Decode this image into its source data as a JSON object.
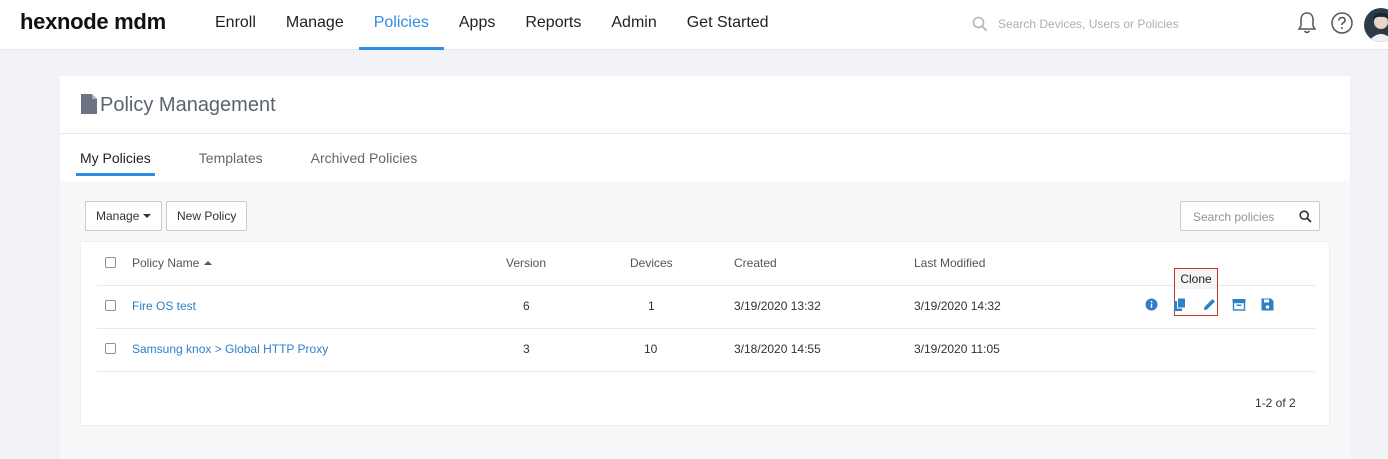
{
  "brand": {
    "logo_text": "hexnode mdm",
    "accent": "#2f8de4"
  },
  "nav": {
    "items": [
      {
        "label": "Enroll"
      },
      {
        "label": "Manage"
      },
      {
        "label": "Policies",
        "active": true
      },
      {
        "label": "Apps"
      },
      {
        "label": "Reports"
      },
      {
        "label": "Admin"
      },
      {
        "label": "Get Started"
      }
    ]
  },
  "top_search": {
    "placeholder": "Search Devices, Users or Policies"
  },
  "page": {
    "title": "Policy Management"
  },
  "tabs": [
    {
      "label": "My Policies",
      "active": true
    },
    {
      "label": "Templates"
    },
    {
      "label": "Archived Policies"
    }
  ],
  "toolbar": {
    "manage_label": "Manage",
    "new_policy_label": "New Policy",
    "search_placeholder": "Search policies"
  },
  "table": {
    "columns": [
      "Policy Name",
      "Version",
      "Devices",
      "Created",
      "Last Modified"
    ],
    "rows": [
      {
        "name": "Fire OS test",
        "version": "6",
        "devices": "1",
        "created": "3/19/2020 13:32",
        "modified": "3/19/2020 14:32"
      },
      {
        "name": "Samsung knox > Global HTTP Proxy",
        "version": "3",
        "devices": "10",
        "created": "3/18/2020 14:55",
        "modified": "3/19/2020 11:05"
      }
    ],
    "row_actions": [
      "info-icon",
      "clone-icon",
      "edit-icon",
      "archive-icon",
      "save-icon"
    ],
    "tooltip": "Clone"
  },
  "pagination": {
    "text": "1-2 of 2"
  }
}
